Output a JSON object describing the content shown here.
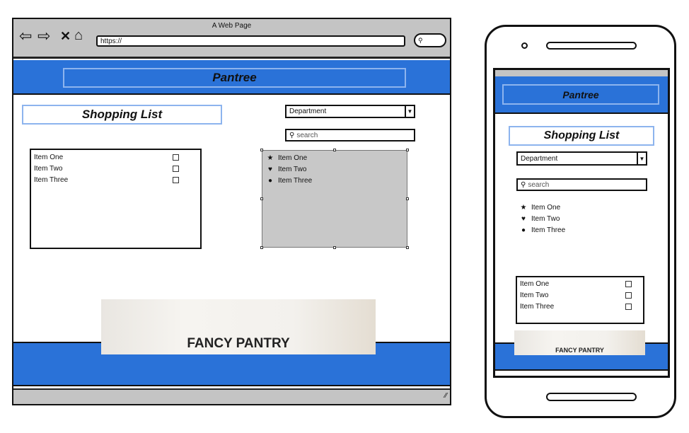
{
  "browser": {
    "title": "A Web Page",
    "url": "https://"
  },
  "desktop": {
    "header_title": "Pantree",
    "page_title": "Shopping List",
    "department_select": "Department",
    "search_placeholder": "search",
    "checklist": [
      "Item One",
      "Item Two",
      "Item Three"
    ],
    "icon_list": [
      {
        "icon": "star-icon",
        "label": "Item One"
      },
      {
        "icon": "heart-icon",
        "label": "Item Two"
      },
      {
        "icon": "circle-icon",
        "label": "Item Three"
      }
    ],
    "banner_text": "FANCY PANTRY"
  },
  "mobile": {
    "header_title": "Pantree",
    "page_title": "Shopping List",
    "department_select": "Department",
    "search_placeholder": "search",
    "icon_list": [
      {
        "icon": "star-icon",
        "label": "Item One"
      },
      {
        "icon": "heart-icon",
        "label": "Item Two"
      },
      {
        "icon": "circle-icon",
        "label": "Item Three"
      }
    ],
    "checklist": [
      "Item One",
      "Item Two",
      "Item Three"
    ],
    "banner_text": "FANCY PANTRY"
  },
  "colors": {
    "header_blue": "#2a72d8",
    "chrome_gray": "#c4c4c4",
    "panel_gray": "#c8c8c8"
  }
}
